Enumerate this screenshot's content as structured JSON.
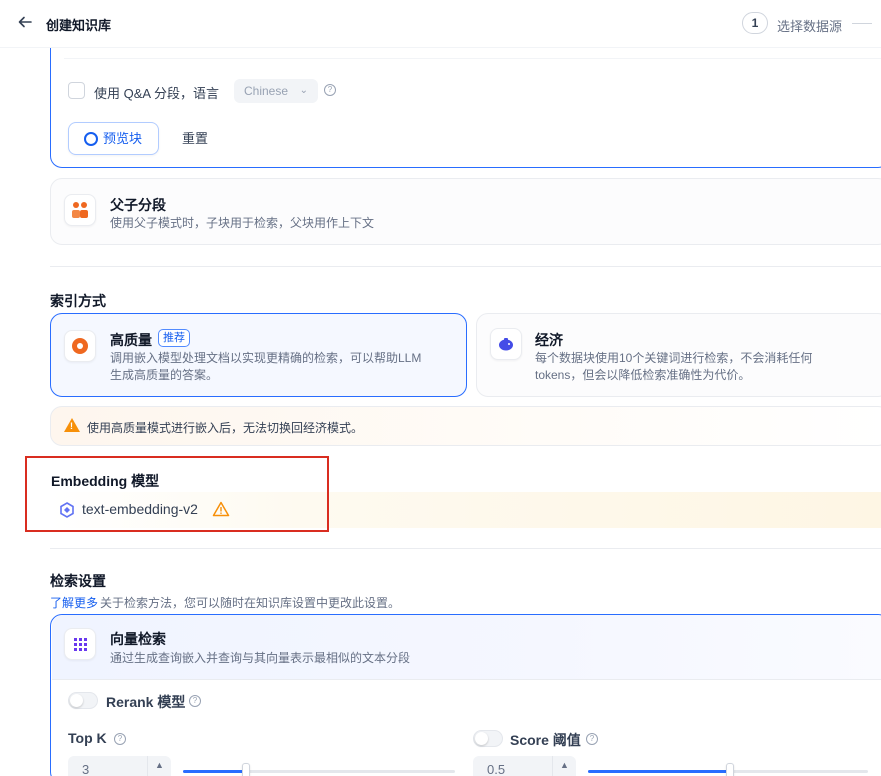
{
  "header": {
    "title": "创建知识库",
    "step_number": "1",
    "step_label": "选择数据源"
  },
  "custom_segment": {
    "qa_label": "使用 Q&A 分段，语言",
    "language_value": "Chinese",
    "preview_label": "预览块",
    "reset_label": "重置"
  },
  "parent_child": {
    "title": "父子分段",
    "desc": "使用父子模式时，子块用于检索，父块用作上下文"
  },
  "index_method": {
    "section_title": "索引方式",
    "high_quality": {
      "title": "高质量",
      "badge": "推荐",
      "desc_line1": "调用嵌入模型处理文档以实现更精确的检索，可以帮助LLM",
      "desc_line2": "生成高质量的答案。"
    },
    "economy": {
      "title": "经济",
      "desc_line1": "每个数据块使用10个关键词进行检索，不会消耗任何",
      "desc_line2": "tokens，但会以降低检索准确性为代价。"
    },
    "warning": "使用高质量模式进行嵌入后，无法切换回经济模式。"
  },
  "embedding": {
    "title": "Embedding 模型",
    "model_name": "text-embedding-v2"
  },
  "retrieval": {
    "section_title": "检索设置",
    "learn_more": "了解更多",
    "learn_rest": "关于检索方法，您可以随时在知识库设置中更改此设置。",
    "vector": {
      "title": "向量检索",
      "desc": "通过生成查询嵌入并查询与其向量表示最相似的文本分段"
    },
    "rerank_label": "Rerank 模型",
    "top_k_label": "Top K",
    "top_k_value": "3",
    "score_label": "Score 阈值",
    "score_value": "0.5"
  },
  "colors": {
    "accent": "#296dff",
    "warning": "#f79009",
    "highlight_box": "#d92d20"
  }
}
